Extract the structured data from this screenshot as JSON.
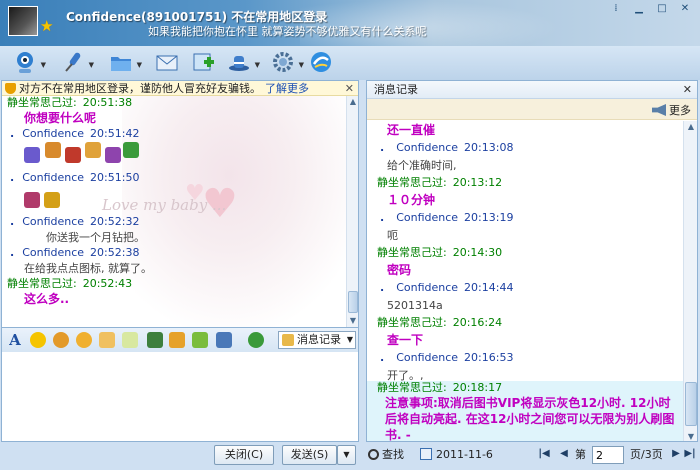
{
  "window": {
    "contact_title": "Confidence(891001751)  不在常用地区登录",
    "signature": "如果我能把你抱在怀里 就算姿势不够优雅又有什么关系呢",
    "controls": [
      "⁞",
      "▁",
      "□",
      "✕"
    ]
  },
  "warning": {
    "text": "对方不在常用地区登录，谨防他人冒充好友骗钱。",
    "link": "了解更多",
    "close": "✕"
  },
  "chat": [
    {
      "sender": "静坐常思己过:",
      "time": "20:51:38",
      "who": "me",
      "text": "你想要什么呢",
      "style": "purple"
    },
    {
      "sender": "Confidence",
      "time": "20:51:42",
      "who": "other",
      "text": "",
      "style": "emoji"
    },
    {
      "sender": "Confidence",
      "time": "20:51:50",
      "who": "other",
      "text": "",
      "style": "emoji"
    },
    {
      "sender": "Confidence",
      "time": "20:52:32",
      "who": "other",
      "text": "你送我一个月钻把。",
      "style": "gray"
    },
    {
      "sender": "Confidence",
      "time": "20:52:38",
      "who": "other",
      "text": "在给我点点图标, 就算了。",
      "style": "gray"
    },
    {
      "sender": "静坐常思己过:",
      "time": "20:52:43",
      "who": "me",
      "text": "这么多..",
      "style": "purple"
    }
  ],
  "background_text": "Love my baby ...",
  "format_toolbar": {
    "message_record_label": "消息记录"
  },
  "buttons": {
    "close_label": "关闭(C)",
    "send_label": "发送(S)",
    "send_dropdown": "▼"
  },
  "history": {
    "title": "消息记录",
    "close": "✕",
    "more_label": "更多",
    "messages": [
      {
        "sender": "",
        "time": "",
        "who": "none",
        "text": "还一直催",
        "style": "purple"
      },
      {
        "sender": "Confidence",
        "time": "20:13:08",
        "who": "other",
        "text": "给个准确时间,",
        "style": "gray"
      },
      {
        "sender": "静坐常思己过:",
        "time": "20:13:12",
        "who": "me",
        "text": "１０分钟",
        "style": "purple"
      },
      {
        "sender": "Confidence",
        "time": "20:13:19",
        "who": "other",
        "text": "呃",
        "style": "gray"
      },
      {
        "sender": "静坐常思己过:",
        "time": "20:14:30",
        "who": "me",
        "text": "密码",
        "style": "purple"
      },
      {
        "sender": "Confidence",
        "time": "20:14:44",
        "who": "other",
        "text": "5201314a",
        "style": "gray"
      },
      {
        "sender": "静坐常思己过:",
        "time": "20:16:24",
        "who": "me",
        "text": "查一下",
        "style": "purple"
      },
      {
        "sender": "Confidence",
        "time": "20:16:53",
        "who": "other",
        "text": "开了。,",
        "style": "gray"
      }
    ],
    "notice": {
      "sender": "静坐常思己过:",
      "time": "20:18:17",
      "text": "注意事项:取消后图书VIP将显示灰色12小时. 12小时后将自动亮起. 在这12小时之间您可以无限为别人刷图书. -"
    }
  },
  "history_footer": {
    "search_label": "查找",
    "date": "2011-11-6",
    "page_prefix": "第",
    "page_value": "2",
    "page_suffix": "页/3页"
  },
  "colors": {
    "self_name": "#008000",
    "other_name": "#1b3fa0",
    "highlight_text": "#c000c0",
    "notice_bg": "#dff4fb"
  }
}
